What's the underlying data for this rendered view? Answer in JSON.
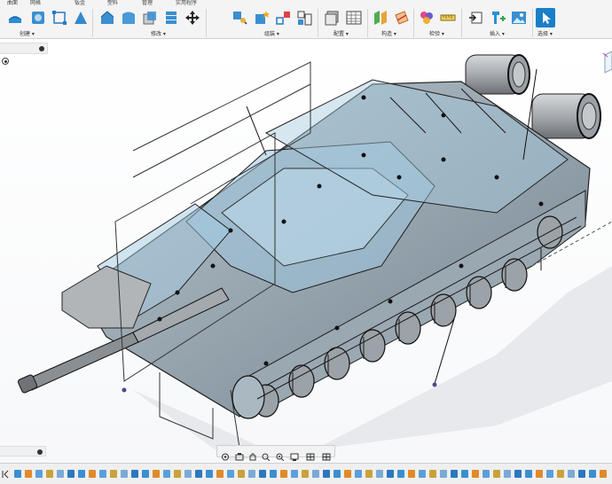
{
  "menu_tabs": [
    "曲面",
    "网格",
    "钣金",
    "塑料",
    "管理",
    "实用程序"
  ],
  "toolbar_groups": [
    {
      "label": "创建 ▾"
    },
    {
      "label": "修改 ▾"
    },
    {
      "label": "组装 ▾"
    },
    {
      "label": "配置 ▾"
    },
    {
      "label": "构造 ▾"
    },
    {
      "label": "检验 ▾"
    },
    {
      "label": "插入 ▾"
    },
    {
      "label": "选择 ▾"
    }
  ],
  "colors": {
    "accent_blue": "#1e8fd6",
    "select_active": "#1a7fc8",
    "body_gray": "#8a9aa6",
    "transparent_blue": "#9fc6de",
    "edge": "#111111"
  },
  "icons": [
    "extrude-icon",
    "revolve-icon",
    "sketch-icon",
    "triangle-icon",
    "fillet-icon",
    "shell-icon",
    "combine-icon",
    "move-icon",
    "joint-icon",
    "component-icon",
    "rigid-group-icon",
    "table-icon",
    "plane-icon",
    "measure-icon",
    "insert-icon",
    "decal-icon",
    "image-icon",
    "select-icon"
  ],
  "navbar_icons": [
    "orbit-icon",
    "look-at-icon",
    "pan-icon",
    "zoom-icon",
    "fit-icon",
    "display-icon",
    "grid-icon",
    "viewports-icon"
  ]
}
